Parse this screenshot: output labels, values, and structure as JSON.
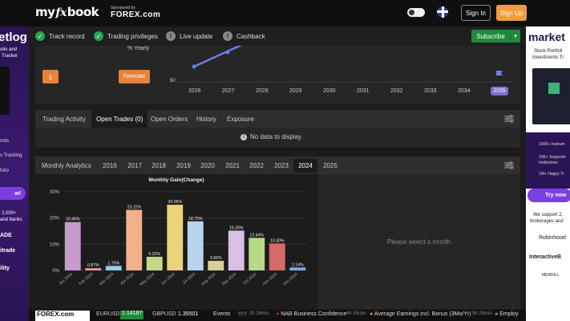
{
  "header": {
    "logo_left": "my",
    "logo_mid": "fx",
    "logo_right": "book",
    "sponsored_label": "Sponsored by",
    "sponsor_name": "FOREX.com",
    "signin_label": "Sign In",
    "signup_label": "Sign Up"
  },
  "nav": {
    "items": [
      {
        "label": "Track record",
        "icon": "check-icon"
      },
      {
        "label": "Trading privileges",
        "icon": "check-icon"
      },
      {
        "label": "Live update",
        "icon": "warning-icon"
      },
      {
        "label": "Cashback",
        "icon": "warning-icon"
      }
    ],
    "subscribe_label": "Subscribe"
  },
  "left_ad": {
    "title": "etlog",
    "line1": "olio and",
    "line2": "Tracker",
    "line3": "ools",
    "line4": "s Tracking",
    "line5": "folio",
    "btn": "w!",
    "line6": "2,000+",
    "line7": "and banks",
    "brand1": "ADE",
    "brand2": "itrade",
    "brand3": "ility"
  },
  "right_ad": {
    "title": "market",
    "line1": "Stock Portfoli",
    "line2": "Investments Tr",
    "f1": "150K+ Instrum",
    "f2": "10K+ Supporte",
    "f2b": "Institutions",
    "f3": "1M+ Happy Tr",
    "btn": "Try now",
    "s1": "We support 2,",
    "s2": "brokerages and",
    "brand1": "Robinhood",
    "brand2": "InteractiveB",
    "brand3": "MERRILL"
  },
  "forecast": {
    "yearly_label": "% Yearly",
    "forecast_label": "Forecast",
    "zero_label": "$0",
    "years": [
      "2026",
      "2027",
      "2028",
      "2029",
      "2030",
      "2031",
      "2032",
      "2033",
      "2034",
      "2035"
    ],
    "selected_year": "2035"
  },
  "trade_tabs": {
    "tabs": [
      "Trading Activity",
      "Open Trades (0)",
      "Open Orders",
      "History",
      "Exposure"
    ],
    "active": "Open Trades (0)",
    "nodata": "No data to display"
  },
  "analytics": {
    "title": "Monthly Analytics",
    "years": [
      "2016",
      "2017",
      "2018",
      "2019",
      "2020",
      "2021",
      "2022",
      "2023",
      "2024",
      "2025"
    ],
    "active_year": "2024",
    "select_prompt": "Please select a month."
  },
  "chart_data": {
    "type": "bar",
    "title": "Monthly Gain(Change)",
    "categories": [
      "Jan 2024",
      "Feb 2024",
      "Mar 2024",
      "Apr 2024",
      "May 2024",
      "Jun 2024",
      "Jul 2024",
      "Aug 2024",
      "Sep 2024",
      "Oct 2024",
      "Nov 2024",
      "Dec 2024"
    ],
    "values": [
      18.46,
      0.87,
      1.75,
      23.11,
      5.22,
      25.06,
      18.75,
      3.66,
      15.2,
      12.44,
      10.3,
      1.14
    ],
    "value_labels": [
      "18.46%",
      "0.87%",
      "1.75%",
      "23.11%",
      "5.22%",
      "25.06%",
      "18.75%",
      "3.66%",
      "15.20%",
      "12.44%",
      "10.30%",
      "1.14%"
    ],
    "colors": [
      "#c49bc9",
      "#e89a9a",
      "#8ed0e6",
      "#f0b08a",
      "#c6d98a",
      "#ecd27a",
      "#b9d3ef",
      "#d8d09a",
      "#d9bee6",
      "#b8d98a",
      "#d46a6a",
      "#7ab0e6"
    ],
    "yticks": [
      "0%",
      "10%",
      "20%",
      "30%"
    ],
    "ylim": [
      0,
      30
    ],
    "grid": true
  },
  "ticker": {
    "brand": "FOREX.com",
    "pair1": "EURUSD",
    "price1": "1.14187",
    "pair2": "GBPUSD",
    "price2": "1.35501",
    "events_label": "Events",
    "yoy": "YoY",
    "t1": "2h 26min",
    "e1": "NAB Business Confidence",
    "t2": "4h 55min",
    "e2": "Average Earnings incl. Bonus (3Mo/Yr)",
    "t3": "9h 25min",
    "e3": "Employ"
  }
}
